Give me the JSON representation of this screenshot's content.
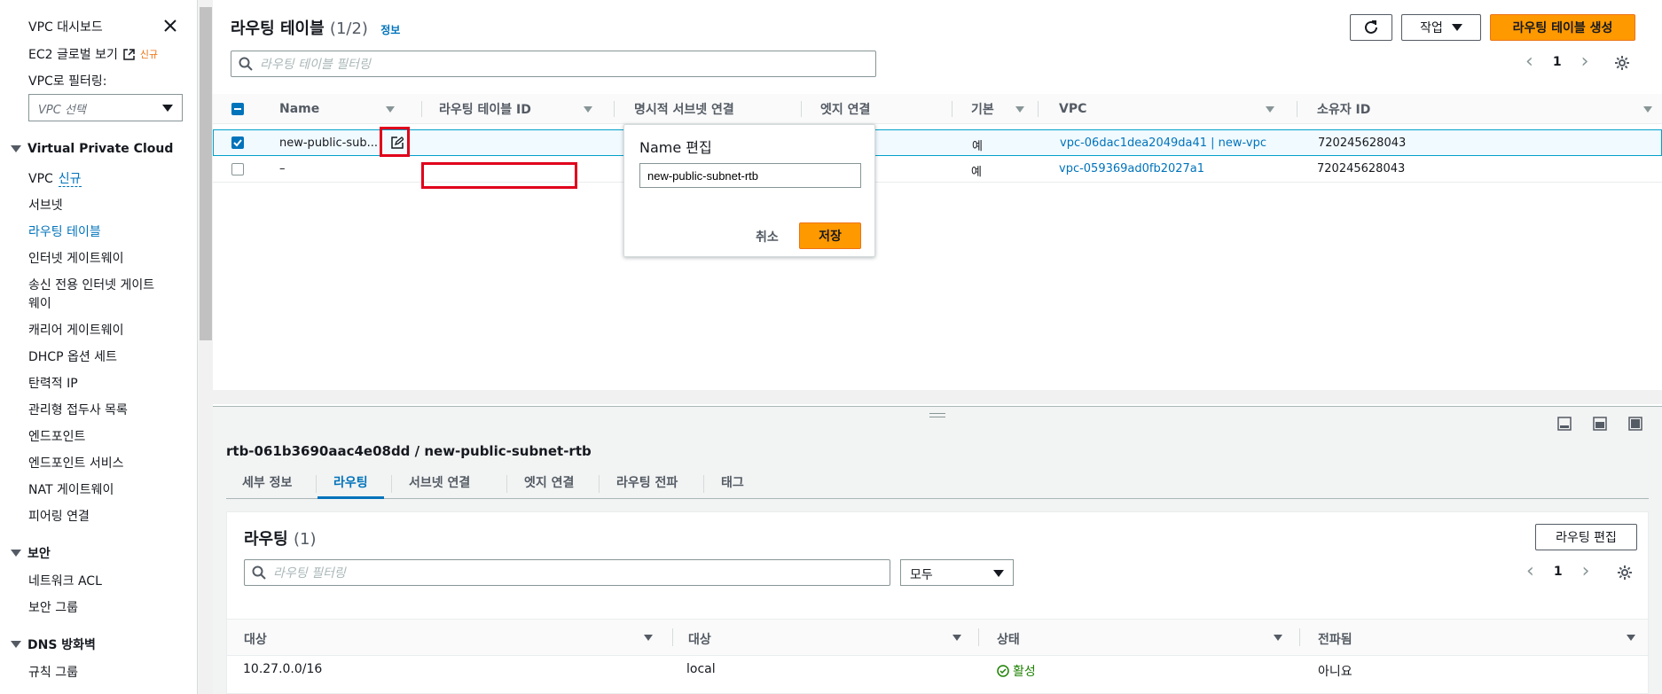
{
  "sidebar": {
    "dashboard": "VPC 대시보드",
    "ec2_global": "EC2 글로벌 보기",
    "ec2_global_badge": "신규",
    "filter_label": "VPC로 필터링:",
    "filter_placeholder": "VPC 선택",
    "section_vpc": "Virtual Private Cloud",
    "items_vpc": [
      {
        "label": "VPC",
        "badge": "신규"
      },
      {
        "label": "서브넷"
      },
      {
        "label": "라우팅 테이블"
      },
      {
        "label": "인터넷 게이트웨이"
      },
      {
        "label": "송신 전용 인터넷 게이트"
      },
      {
        "label": "웨이"
      },
      {
        "label": "캐리어 게이트웨이"
      },
      {
        "label": "DHCP 옵션 세트"
      },
      {
        "label": "탄력적 IP"
      },
      {
        "label": "관리형 접두사 목록"
      },
      {
        "label": "엔드포인트"
      },
      {
        "label": "엔드포인트 서비스"
      },
      {
        "label": "NAT 게이트웨이"
      },
      {
        "label": "피어링 연결"
      }
    ],
    "section_security": "보안",
    "items_security": [
      "네트워크 ACL",
      "보안 그룹"
    ],
    "section_dns": "DNS 방화벽",
    "items_dns": [
      "규칙 그룹"
    ]
  },
  "top": {
    "title": "라우팅 테이블",
    "count": "(1/2)",
    "info": "정보",
    "actions_label": "작업",
    "create_label": "라우팅 테이블 생성",
    "filter_placeholder": "라우팅 테이블 필터링",
    "page": "1"
  },
  "table": {
    "columns": [
      "Name",
      "라우팅 테이블 ID",
      "명시적 서브넷 연결",
      "엣지 연결",
      "기본",
      "VPC",
      "소유자 ID"
    ],
    "rows": [
      {
        "name": "new-public-sub...",
        "edge": "–",
        "main": "예",
        "vpc": "vpc-06dac1dea2049da41 | new-vpc",
        "owner": "720245628043"
      },
      {
        "name": "–",
        "edge": "–",
        "main": "예",
        "vpc": "vpc-059369ad0fb2027a1",
        "owner": "720245628043"
      }
    ]
  },
  "popover": {
    "title": "Name 편집",
    "value": "new-public-subnet-rtb",
    "cancel": "취소",
    "save": "저장"
  },
  "detail": {
    "title": "rtb-061b3690aac4e08dd / new-public-subnet-rtb",
    "tabs": [
      "세부 정보",
      "라우팅",
      "서브넷 연결",
      "엣지 연결",
      "라우팅 전파",
      "태그"
    ],
    "active_tab": "라우팅"
  },
  "routes": {
    "title": "라우팅",
    "count": "(1)",
    "edit_label": "라우팅 편집",
    "filter_placeholder": "라우팅 필터링",
    "select_value": "모두",
    "page": "1",
    "columns": [
      "대상",
      "대상",
      "상태",
      "전파됨"
    ],
    "rows": [
      {
        "destination": "10.27.0.0/16",
        "target": "local",
        "status": "활성",
        "propagated": "아니요"
      }
    ]
  },
  "colors": {
    "accent": "#0073bb",
    "primary_button": "#ff9900",
    "highlight_box": "#e0001b",
    "status_active": "#1d8102"
  }
}
